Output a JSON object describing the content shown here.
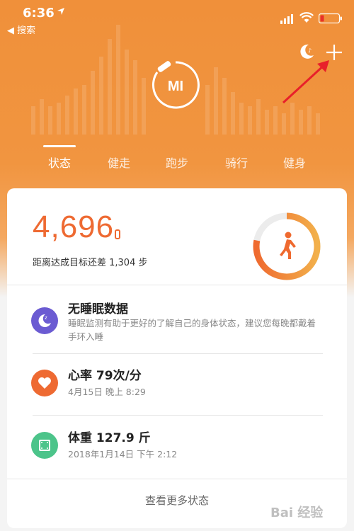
{
  "status_bar": {
    "time": "6:36",
    "back_label": "◀ 搜索"
  },
  "header": {
    "logo_text": "MI",
    "tabs": [
      {
        "label": "状态",
        "active": true
      },
      {
        "label": "健走",
        "active": false
      },
      {
        "label": "跑步",
        "active": false
      },
      {
        "label": "骑行",
        "active": false
      },
      {
        "label": "健身",
        "active": false
      }
    ]
  },
  "steps": {
    "count": "4,696",
    "goal_text": "距离达成目标还差 1,304 步",
    "progress": 0.78
  },
  "rows": [
    {
      "title": "无睡眠数据",
      "subtitle": "睡眠监测有助于更好的了解自己的身体状态，建议您每晚都戴着手环入睡",
      "icon": "moon-icon",
      "color": "#6b5bd2"
    },
    {
      "title": "心率 79次/分",
      "subtitle": "4月15日 晚上 8:29",
      "icon": "heart-icon",
      "color": "#ee6a32"
    },
    {
      "title": "体重 127.9 斤",
      "subtitle": "2018年1月14日 下午 2:12",
      "icon": "scale-icon",
      "color": "#4cc48a"
    }
  ],
  "more_label": "查看更多状态",
  "watermark": "Bai 经验",
  "colors": {
    "accent": "#ee6a32",
    "header": "#f0903a"
  }
}
